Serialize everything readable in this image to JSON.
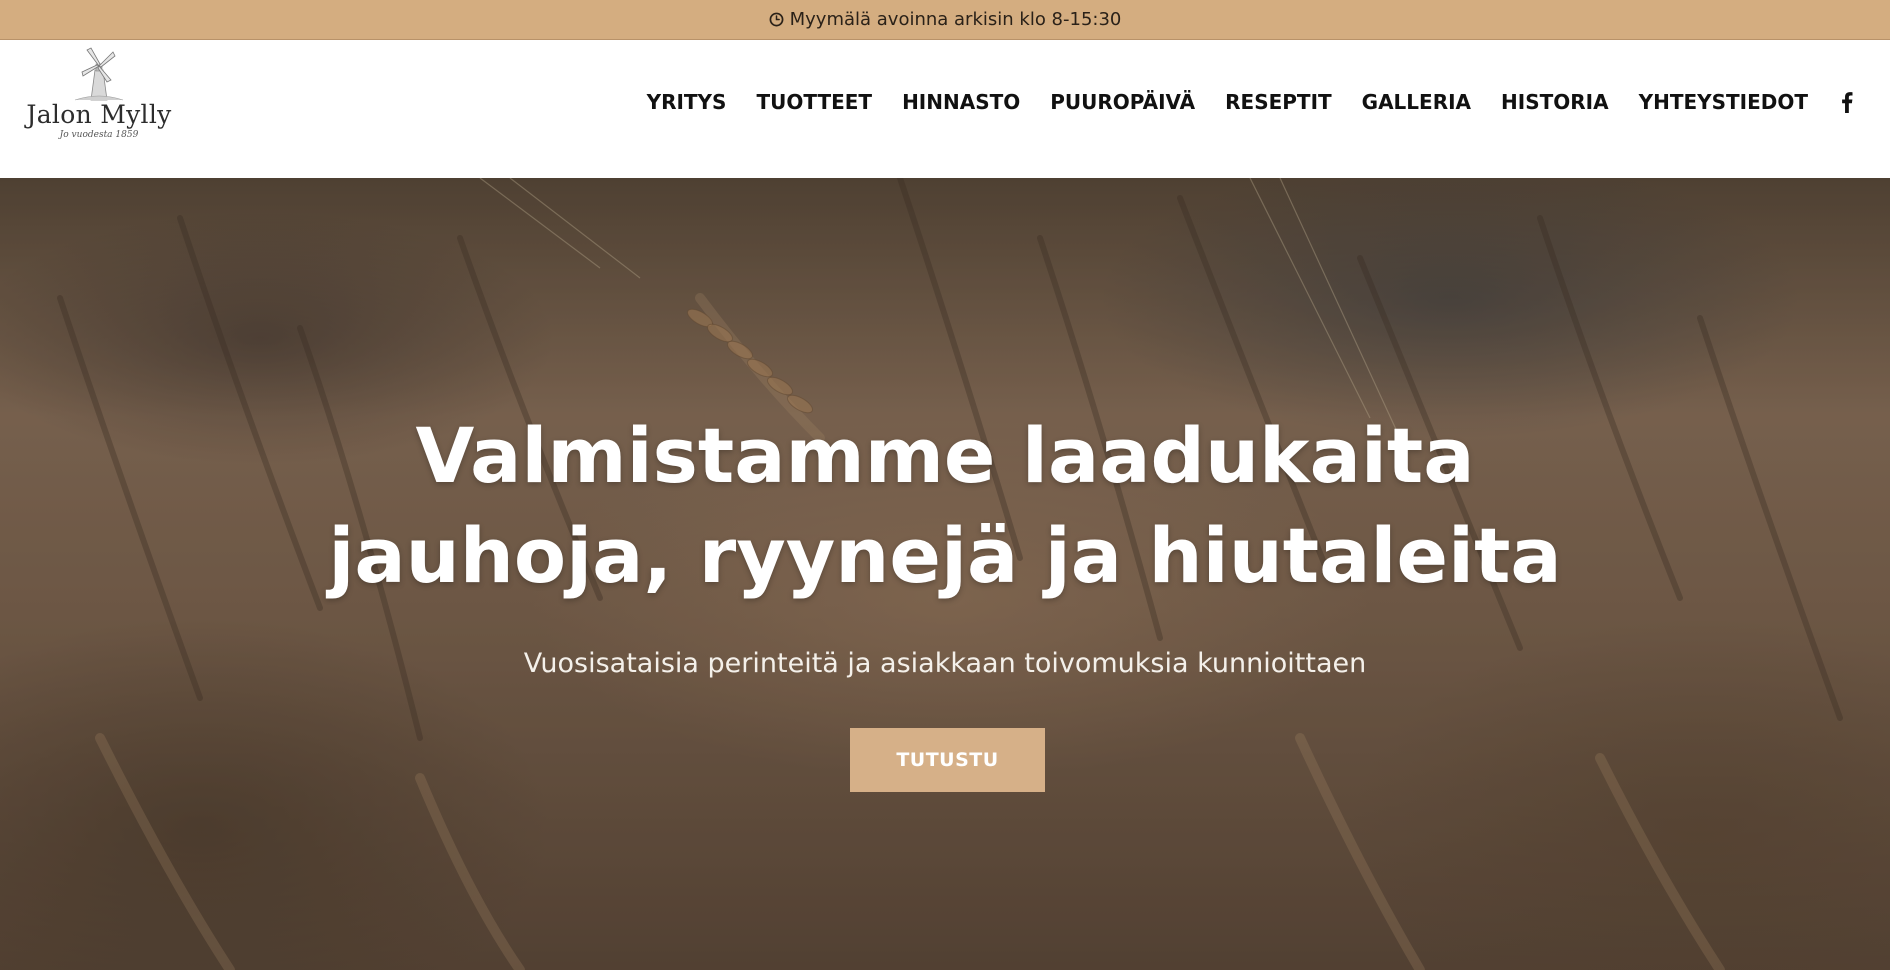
{
  "topbar": {
    "icon": "clock-icon",
    "text": "Myymälä avoinna arkisin klo 8-15:30",
    "background": "#d4ad80"
  },
  "logo": {
    "name": "Jalon Mylly",
    "tagline": "Jo vuodesta 1859",
    "icon": "windmill-icon"
  },
  "nav": {
    "items": [
      {
        "label": "YRITYS"
      },
      {
        "label": "TUOTTEET"
      },
      {
        "label": "HINNASTO"
      },
      {
        "label": "PUUROPÄIVÄ"
      },
      {
        "label": "RESEPTIT"
      },
      {
        "label": "GALLERIA"
      },
      {
        "label": "HISTORIA"
      },
      {
        "label": "YHTEYSTIEDOT"
      }
    ],
    "social_icon": "facebook-icon"
  },
  "hero": {
    "title_line1": "Valmistamme laadukaita",
    "title_line2": "jauhoja, ryynejä ja hiutaleita",
    "subtitle": "Vuosisataisia perinteitä ja asiakkaan toivomuksia kunnioittaen",
    "cta_label": "TUTUSTU",
    "cta_color": "#d6b088"
  }
}
